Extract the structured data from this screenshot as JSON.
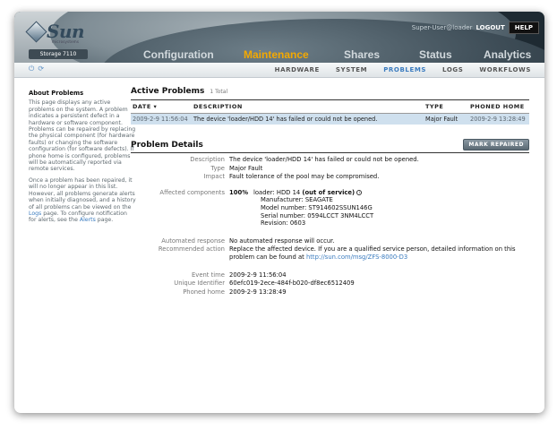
{
  "brand": {
    "name": "Sun",
    "sub": "microsystems",
    "product": "Storage 7110"
  },
  "user": {
    "name": "Super-User@loader",
    "logout": "LOGOUT",
    "help": "HELP"
  },
  "main_tabs": [
    "Configuration",
    "Maintenance",
    "Shares",
    "Status",
    "Analytics"
  ],
  "active_main_tab": "Maintenance",
  "sub_tabs": [
    "HARDWARE",
    "SYSTEM",
    "PROBLEMS",
    "LOGS",
    "WORKFLOWS"
  ],
  "active_sub_tab": "PROBLEMS",
  "sidebar": {
    "title": "About Problems",
    "p1": "This page displays any active problems on the system. A problem indicates a persistent defect in a hardware or software component. Problems can be repaired by replacing the physical component (for hardware faults) or changing the software configuration (for software defects). If phone home is configured, problems will be automatically reported via remote services.",
    "p2_a": "Once a problem has been repaired, it will no longer appear in this list. However, all problems generate alerts when initially diagnosed, and a history of all problems can be viewed on the ",
    "p2_link1": "Logs",
    "p2_b": " page. To configure notification for alerts, see the ",
    "p2_link2": "Alerts",
    "p2_c": " page."
  },
  "active_problems": {
    "title": "Active Problems",
    "count": "1 Total",
    "columns": [
      "DATE ▾",
      "DESCRIPTION",
      "TYPE",
      "PHONED HOME"
    ],
    "rows": [
      {
        "date": "2009-2-9 11:56:04",
        "description": "The device 'loader/HDD 14' has failed or could not be opened.",
        "type": "Major Fault",
        "phoned_home": "2009-2-9 13:28:49"
      }
    ]
  },
  "details": {
    "title": "Problem Details",
    "mark_button": "MARK REPAIRED",
    "labels": {
      "description": "Description",
      "type": "Type",
      "impact": "Impact",
      "affected": "Affected components",
      "automated": "Automated response",
      "recommended": "Recommended action",
      "event_time": "Event time",
      "uuid": "Unique Identifier",
      "phoned_home": "Phoned home"
    },
    "description": "The device 'loader/HDD 14' has failed or could not be opened.",
    "type": "Major Fault",
    "impact": "Fault tolerance of the pool may be compromised.",
    "affected": {
      "percent": "100%",
      "component": "loader: HDD 14",
      "status": "(out of service)",
      "manufacturer": "Manufacturer: SEAGATE",
      "model": "Model number: ST914602SSUN146G",
      "serial": "Serial number: 0594LCCT 3NM4LCCT",
      "revision": "Revision: 0603"
    },
    "automated": "No automated response will occur.",
    "recommended": "Replace the affected device. If you are a qualified service person, detailed information on this problem can be found at ",
    "recommended_link": "http://sun.com/msg/ZFS-8000-D3",
    "event_time": "2009-2-9 11:56:04",
    "uuid": "60efc019-2ece-484f-b020-df8ec6512409",
    "phoned_home": "2009-2-9 13:28:49"
  }
}
